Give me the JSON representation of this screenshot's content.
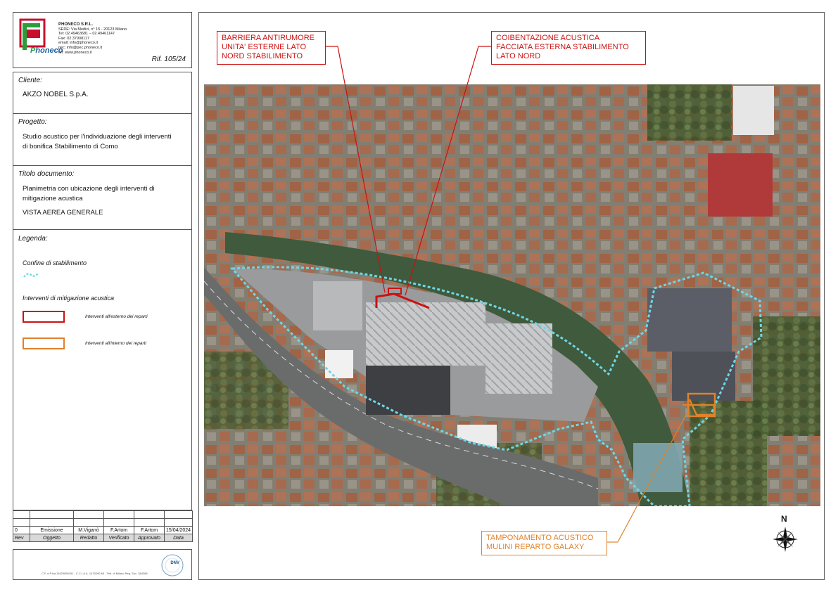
{
  "company": {
    "logo_letter": "P",
    "logo_word": "honeco",
    "name": "PHONECO S.R.L.",
    "lines": [
      "SEDE: Via Medici, n° 15 - 20123 Milano",
      "Tel: 02.49463681 – 02.49461147",
      "Fax: 02.37908117",
      "email: info@phoneco.it",
      "pec: info@pec.phoneco.it",
      "url: www.phoneco.it"
    ],
    "ref": "Rif. 105/24"
  },
  "client": {
    "label": "Cliente:",
    "value": "AKZO NOBEL S.p.A."
  },
  "project": {
    "label": "Progetto:",
    "lines": [
      "Studio acustico per l'individuazione degli interventi",
      "di bonifica Stabilimento di Como"
    ]
  },
  "document": {
    "label": "Titolo documento:",
    "lines": [
      "Planimetria con ubicazione degli interventi di",
      "mitigazione acustica"
    ],
    "subtitle": "VISTA AEREA GENERALE"
  },
  "legend": {
    "label": "Legenda:",
    "boundary_label": "Confine di stabilimento",
    "mitigation_label": "Interventi di mitigazione acustica",
    "items": [
      {
        "label": "Interventi all'esterno dei reparti",
        "color": "#cc1111"
      },
      {
        "label": "Interventi all'interno dei reparti",
        "color": "#e0822a"
      }
    ],
    "boundary_color": "#6fd6e6"
  },
  "revisions": {
    "headers": [
      "Rev",
      "Oggetto",
      "Redatto",
      "Verificato",
      "Approvato",
      "Data"
    ],
    "rows": [
      [
        "0",
        "Emissione",
        "M.Viganò",
        "F.Artom",
        "F.Artom",
        "15/04/2024"
      ]
    ]
  },
  "footer": {
    "text": "C.F. e P.Iva 11629850151 - C.C.I.A.A. 1470290 MI - Trib. di Milano Reg. Soc. 384368",
    "cert": "DNV"
  },
  "callouts": {
    "barrier": [
      "BARRIERA ANTIRUMORE",
      "UNITA' ESTERNE LATO",
      "NORD STABILIMENTO"
    ],
    "insulation": [
      "COIBENTAZIONE ACUSTICA",
      "FACCIATA ESTERNA STABILIMENTO",
      "LATO NORD"
    ],
    "panel": [
      "TAMPONAMENTO ACUSTICO",
      "MULINI REPARTO GALAXY"
    ]
  },
  "north": "N"
}
